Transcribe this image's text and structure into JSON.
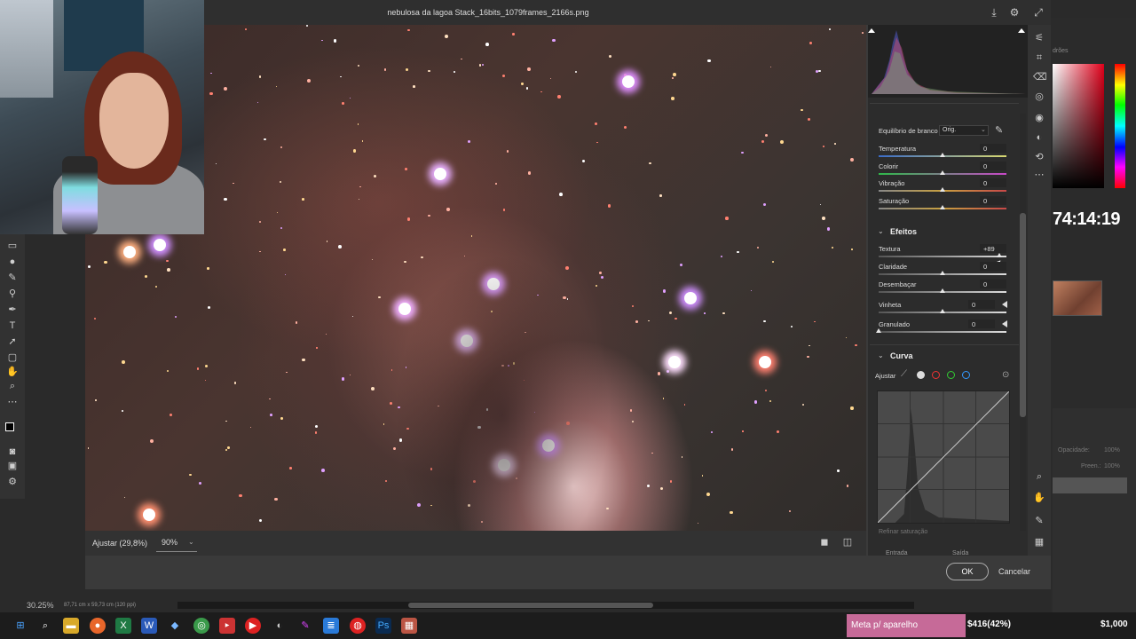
{
  "photoshop": {
    "zoom": "30.25%",
    "doc_info": "87,71 cm x 59,73 cm (120 ppi)",
    "right_label": "drões",
    "timer": "74:14:19",
    "layers_opacity_label": "Opacidade:",
    "layers_opacity_value": "100%",
    "layers_fill_label": "Preen.:",
    "layers_fill_value": "100%"
  },
  "camera_raw": {
    "title": "nebulosa da lagoa Stack_16bits_1079frames_2166s.png",
    "bottom_bar": {
      "adjust_label": "Ajustar (29,8%)",
      "zoom_value": "90%"
    },
    "footer": {
      "ok_label": "OK",
      "cancel_label": "Cancelar"
    },
    "white_balance": {
      "label": "Equilíbrio de branco",
      "value": "Orig."
    },
    "basic_sliders": [
      {
        "label": "Temperatura",
        "value": "0"
      },
      {
        "label": "Colorir",
        "value": "0"
      },
      {
        "label": "Vibração",
        "value": "0"
      },
      {
        "label": "Saturação",
        "value": "0"
      }
    ],
    "effects": {
      "title": "Efeitos",
      "sliders": [
        {
          "label": "Textura",
          "value": "+89"
        },
        {
          "label": "Claridade",
          "value": "0"
        },
        {
          "label": "Desembaçar",
          "value": "0"
        },
        {
          "label": "Vinheta",
          "value": "0"
        },
        {
          "label": "Granulado",
          "value": "0"
        }
      ]
    },
    "curve": {
      "title": "Curva",
      "adjust_label": "Ajustar",
      "refine_label": "Refinar saturação",
      "input_label": "Entrada",
      "output_label": "Saída"
    }
  },
  "taskbar": {
    "stream_label": "Meta p/ aparelho",
    "progress": "$416(42%)",
    "goal": "$1,000"
  },
  "colors": {
    "accent_pink": "#c66a98",
    "picker_red": "#e0001a"
  }
}
